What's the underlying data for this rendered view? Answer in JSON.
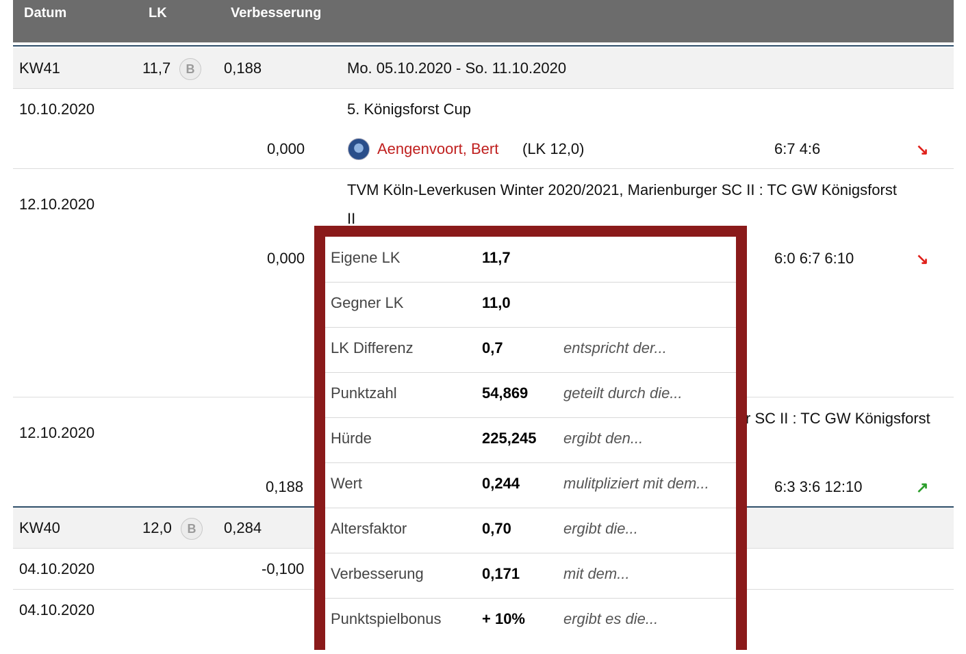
{
  "header": {
    "col_date": "Datum",
    "col_lk": "LK",
    "col_improvement": "Verbesserung"
  },
  "week41": {
    "label": "KW41",
    "lk": "11,7",
    "badge": "B",
    "improvement": "0,188",
    "range": "Mo. 05.10.2020 - So. 11.10.2020"
  },
  "match1": {
    "date": "10.10.2020",
    "event": "5. Königsforst Cup",
    "improvement": "0,000",
    "opponent": "Aengenvoort, Bert",
    "opponent_lk": "(LK 12,0)",
    "score": "6:7 4:6",
    "trend_icon": "arrow-down-right"
  },
  "match2": {
    "date": "12.10.2020",
    "event_line1": "TVM Köln-Leverkusen Winter 2020/2021, Marienburger SC II : TC GW Königsforst",
    "event_line2": "II",
    "improvement": "0,000",
    "score": "6:0 6:7 6:10",
    "trend_icon": "arrow-down-right"
  },
  "match3": {
    "date": "12.10.2020",
    "event_partial": "r SC II : TC GW Königsforst",
    "improvement": "0,188",
    "score": "6:3 3:6 12:10",
    "trend_icon": "arrow-up-right"
  },
  "week40": {
    "label": "KW40",
    "lk": "12,0",
    "badge": "B",
    "improvement": "0,284"
  },
  "match4": {
    "date": "04.10.2020",
    "improvement": "-0,100"
  },
  "match5": {
    "date": "04.10.2020"
  },
  "colors": {
    "header_bg": "#6c6c6c",
    "popup_border": "#8a1a1a",
    "opponent_link": "#c0201f",
    "arrow_down": "#e0201a",
    "arrow_up": "#2a9d2a"
  },
  "popup": {
    "rows": [
      {
        "label": "Eigene LK",
        "value": "11,7",
        "note": ""
      },
      {
        "label": "Gegner LK",
        "value": "11,0",
        "note": ""
      },
      {
        "label": "LK Differenz",
        "value": "0,7",
        "note": "entspricht der..."
      },
      {
        "label": "Punktzahl",
        "value": "54,869",
        "note": "geteilt durch die..."
      },
      {
        "label": "Hürde",
        "value": "225,245",
        "note": "ergibt den..."
      },
      {
        "label": "Wert",
        "value": "0,244",
        "note": "mulitpliziert mit dem..."
      },
      {
        "label": "Altersfaktor",
        "value": "0,70",
        "note": "ergibt die..."
      },
      {
        "label": "Verbesserung",
        "value": "0,171",
        "note": "mit dem..."
      },
      {
        "label": "Punktspielbonus",
        "value": "+ 10%",
        "note": "ergibt es die..."
      }
    ]
  }
}
